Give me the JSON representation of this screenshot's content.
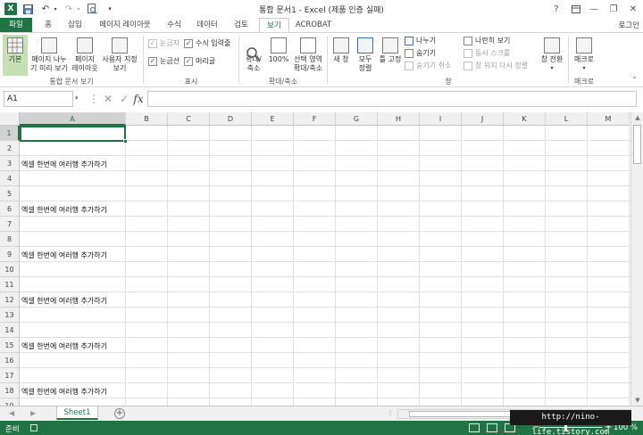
{
  "titlebar": {
    "app_icon": "X",
    "title": "통합 문서1 - Excel (제품 인증 실패)",
    "help": "?",
    "minimize": "—",
    "restore": "❐",
    "close": "✕"
  },
  "tabs": {
    "file": "파일",
    "home": "홈",
    "insert": "삽입",
    "page_layout": "페이지 레이아웃",
    "formulas": "수식",
    "data": "데이터",
    "review": "검토",
    "view": "보기",
    "acrobat": "ACROBAT",
    "signin": "로그인"
  },
  "ribbon": {
    "normal": "기본",
    "page_break_preview": "페이지 나누\n기 미리 보기",
    "page_layout": "페이지\n레이아웃",
    "custom_views": "사용자 지정\n보기",
    "group_workbook_views": "통합 문서 보기",
    "ruler": "눈금자",
    "formula_bar": "수식 입력줄",
    "gridlines": "눈금선",
    "headings": "머리글",
    "group_show": "표시",
    "zoom": "확대/\n축소",
    "zoom_100": "100%",
    "zoom_selection": "선택 영역\n확대/축소",
    "group_zoom": "확대/축소",
    "new_window": "새 창",
    "arrange_all": "모두\n정렬",
    "freeze_panes": "틀 고정",
    "split": "나누기",
    "hide": "숨기기",
    "unhide": "숨기기 취소",
    "view_side_by_side": "나란히 보기",
    "synchronous_scrolling": "동시 스크롤",
    "reset_window_position": "창 위치 다시 정렬",
    "group_window": "창",
    "switch_windows": "창 전환",
    "macros": "매크로",
    "group_macros": "매크로"
  },
  "formula_bar": {
    "name_box": "A1",
    "cancel": "✕",
    "enter": "✓",
    "fx": "fx",
    "value": ""
  },
  "grid": {
    "columns": [
      "A",
      "B",
      "C",
      "D",
      "E",
      "F",
      "G",
      "H",
      "I",
      "J",
      "K",
      "L",
      "M"
    ],
    "rows": [
      "1",
      "2",
      "3",
      "4",
      "5",
      "6",
      "7",
      "8",
      "9",
      "10",
      "11",
      "12",
      "13",
      "14",
      "15",
      "16",
      "17",
      "18",
      "19"
    ],
    "cells": {
      "A3": "엑셀 한번에 여러행 추가하기",
      "A6": "엑셀 한번에 여러행 추가하기",
      "A9": "엑셀 한번에 여러행 추가하기",
      "A12": "엑셀 한번에 여러행 추가하기",
      "A15": "엑셀 한번에 여러행 추가하기",
      "A18": "엑셀 한번에 여러행 추가하기"
    },
    "selected_cell": "A1"
  },
  "sheets": {
    "tabs": [
      "Sheet1"
    ],
    "add": "+"
  },
  "status": {
    "ready": "준비",
    "zoom": "100 %"
  },
  "watermark": "http://nino-life.tistory.com"
}
